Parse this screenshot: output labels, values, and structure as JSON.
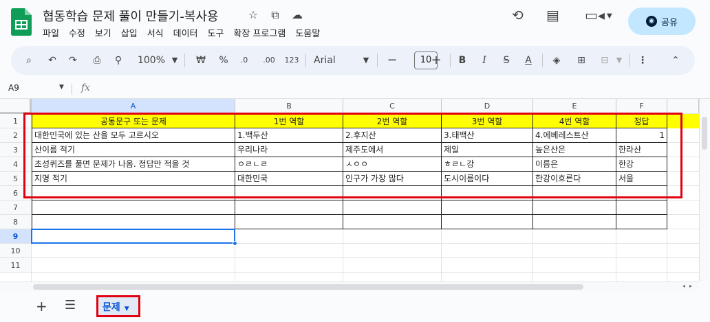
{
  "document": {
    "title": "협동학습 문제 풀이 만들기-복사용"
  },
  "menu": [
    "파일",
    "수정",
    "보기",
    "삽입",
    "서식",
    "데이터",
    "도구",
    "확장 프로그램",
    "도움말"
  ],
  "share": {
    "label": "공유"
  },
  "toolbar": {
    "zoom": "100%",
    "currency": "₩",
    "percent": "%",
    "decrease_decimal": ".0",
    "increase_decimal": ".00",
    "number_format": "123",
    "font": "Arial",
    "font_size": "10"
  },
  "formula_bar": {
    "cell_ref": "A9",
    "fx": "fx"
  },
  "grid": {
    "columns": [
      "A",
      "B",
      "C",
      "D",
      "E",
      "F"
    ],
    "rows": [
      "1",
      "2",
      "3",
      "4",
      "5",
      "6",
      "7",
      "8",
      "9",
      "10",
      "11"
    ],
    "cells": [
      [
        "공통문구 또는 문제",
        "1번 역할",
        "2번 역할",
        "3번 역할",
        "4번 역할",
        "정답"
      ],
      [
        "대한민국에 있는 산을 모두 고르시오",
        "1.백두산",
        "2.후지산",
        "3.태백산",
        "4.에베레스트산",
        "1"
      ],
      [
        "산이름 적기",
        "우리나라",
        "제주도에서",
        "제일",
        "높은산은",
        "한라산"
      ],
      [
        "초성퀴즈를 풀면 문제가 나옴. 정답만 적을 것",
        "ㅇㄹㄴㄹ",
        "ㅅㅇㅇ",
        "ㅎㄹㄴ강",
        "이름은",
        "한강"
      ],
      [
        "지명 적기",
        "대한민국",
        "인구가 가장 많다",
        "도시이름이다",
        "한강이흐른다",
        "서울"
      ]
    ]
  },
  "sheets": [
    {
      "name": "문제"
    }
  ],
  "colors": {
    "header_fill": "#ffff00",
    "selection": "#1a73e8",
    "highlight_box": "#e0000f",
    "share_bg": "#c2e7ff"
  },
  "icons": {
    "logo": "sheets-logo-icon",
    "star": "star-icon",
    "move": "folder-move-icon",
    "cloud": "cloud-status-icon",
    "history": "history-icon",
    "comments": "comments-icon",
    "meet": "video-call-icon",
    "search": "search-icon",
    "undo": "undo-icon",
    "redo": "redo-icon",
    "print": "print-icon",
    "paint_format": "paint-format-icon"
  }
}
